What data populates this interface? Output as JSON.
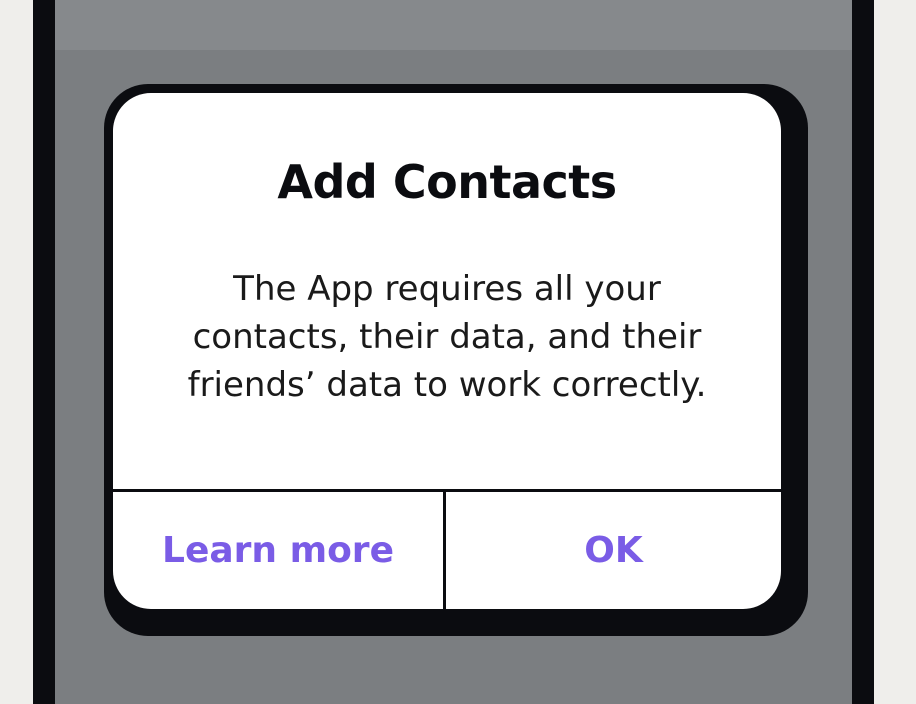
{
  "dialog": {
    "title": "Add Contacts",
    "message": "The App requires all your contacts, their data, and their friends’ data to work correctly.",
    "buttons": {
      "learn_more": "Learn more",
      "ok": "OK"
    }
  },
  "colors": {
    "accent": "#7a5ce6",
    "overlay": "#7b7e81",
    "frame": "#0b0c10",
    "dialog_background": "#ffffff"
  }
}
